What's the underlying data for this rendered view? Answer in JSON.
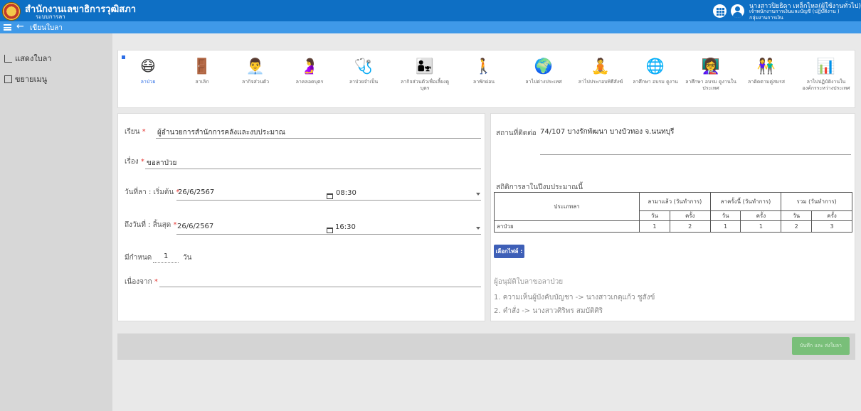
{
  "header": {
    "org_title": "สำนักงานเลขาธิการวุฒิสภา",
    "org_subtitle": "ระบบการลา",
    "user_name": "นางสาวปิยธิดา เหล็กไหล(ผู้ใช้งานทั่วไป)",
    "user_position": "เจ้าพนักงานการเงินและบัญชี (ปฏิบัติงาน )",
    "user_group": "กลุ่มงานการเงิน",
    "apps_icon": "apps-grid-icon",
    "user_icon": "user-icon",
    "bar_color": "#0e6fc4"
  },
  "subbar": {
    "page_title": "เขียนใบลา",
    "back_glyph": "←",
    "bar_color": "#3f99e8"
  },
  "sidebar": {
    "items": [
      {
        "label": "แสดงใบลา",
        "icon": "rss-icon"
      },
      {
        "label": "ขยายเมนู",
        "icon": "expand-icon"
      }
    ]
  },
  "leave_types": [
    {
      "label": "ลาป่วย",
      "glyph": "😷",
      "active": true
    },
    {
      "label": "ลาเลิก",
      "glyph": "🚪",
      "active": false
    },
    {
      "label": "ลากิจส่วนตัว",
      "glyph": "👨‍💼",
      "active": false
    },
    {
      "label": "ลาคลอดบุตร",
      "glyph": "🤰",
      "active": false
    },
    {
      "label": "ลาป่วยจำเป็น",
      "glyph": "🩺",
      "active": false
    },
    {
      "label": "ลากิจส่วนตัวเพื่อเลี้ยงดูบุตร",
      "glyph": "👨‍👧",
      "active": false
    },
    {
      "label": "ลาพักผ่อน",
      "glyph": "🚶",
      "active": false
    },
    {
      "label": "ลาไปต่างประเทศ",
      "glyph": "🌍",
      "active": false
    },
    {
      "label": "ลาไปประกอบพิธีสังฆ์",
      "glyph": "🧘",
      "active": false
    },
    {
      "label": "ลาศึกษา อบรม ดูงาน",
      "glyph": "🌐",
      "active": false
    },
    {
      "label": "ลาศึกษา อบรม ดูงานในประเทศ",
      "glyph": "👩‍🏫",
      "active": false
    },
    {
      "label": "ลาติดตามคู่สมรส",
      "glyph": "👫",
      "active": false
    },
    {
      "label": "ลาไปปฏิบัติงานในองค์กรระหว่างประเทศ",
      "glyph": "📊",
      "active": false
    }
  ],
  "form": {
    "to_label": "เรียน",
    "to_value": "ผู้อำนวยการสำนักการคลังและงบประมาณ",
    "subject_label": "เรื่อง",
    "subject_value": "ขอลาป่วย",
    "start_label": "วันที่ลา : เริ่มต้น",
    "start_date": "26/6/2567",
    "start_time": "08:30",
    "end_label": "ถึงวันที่ : สิ้นสุด",
    "end_date": "26/6/2567",
    "end_time": "16:30",
    "duration_label": "มีกำหนด",
    "duration_value": "1",
    "duration_unit": "วัน",
    "reason_label": "เนื่องจาก",
    "reason_value": "",
    "required_mark": "*"
  },
  "contact": {
    "label": "สถานที่ติดต่อ",
    "value": "74/107 บางรักพัฒนา บางบัวทอง จ.นนทบุรี"
  },
  "stats": {
    "title": "สถิติการลาในปีงบประมาณนี้",
    "col_type": "ประเภทลา",
    "col_used": "ลามาแล้ว (วันทำการ)",
    "col_this": "ลาครั้งนี้ (วันทำการ)",
    "col_total": "รวม (วันทำการ)",
    "sub_day": "วัน",
    "sub_times": "ครั้ง",
    "rows": [
      {
        "type": "ลาป่วย",
        "used_days": "1",
        "used_times": "2",
        "this_days": "1",
        "this_times": "1",
        "total_days": "2",
        "total_times": "3"
      }
    ]
  },
  "file_button": "เลือกไฟล์ :",
  "approvers": {
    "title": "ผู้อนุมัติใบลาขอลาป่วย",
    "line1": "1. ความเห็นผู้บังคับบัญชา -> นางสาวเกตุแก้ว ชูสังข์",
    "line2": "2. คำสั่ง -> นางสาวศิริพร สมบัติศิริ"
  },
  "footer": {
    "save_label": "บันทึก และ ส่งใบลา",
    "save_color": "#79bf79"
  }
}
